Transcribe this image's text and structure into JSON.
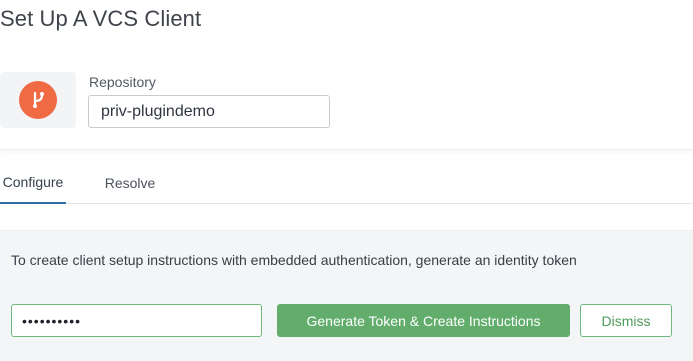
{
  "page": {
    "title": "Set Up A VCS Client"
  },
  "repository": {
    "label": "Repository",
    "value": "priv-plugindemo",
    "icon": "git-branch-icon",
    "icon_color": "#f06a44"
  },
  "tabs": [
    {
      "label": "Configure",
      "active": true
    },
    {
      "label": "Resolve",
      "active": false
    }
  ],
  "token_panel": {
    "instructions": "To create client setup instructions with embedded authentication, generate an identity token",
    "password_value": "••••••••••",
    "generate_label": "Generate Token & Create Instructions",
    "dismiss_label": "Dismiss",
    "accent_color": "#62ad6c"
  }
}
